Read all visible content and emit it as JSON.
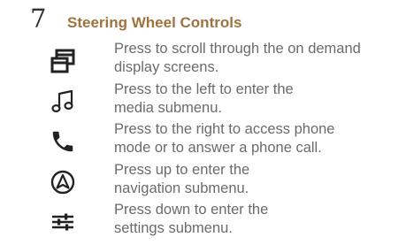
{
  "header": {
    "section_number": "7",
    "title": "Steering Wheel Controls"
  },
  "items": [
    {
      "icon": "screens-icon",
      "line1": "Press to scroll through the on demand",
      "line2": "display screens."
    },
    {
      "icon": "music-note-icon",
      "line1": "Press to the left to enter the",
      "line2": "media submenu."
    },
    {
      "icon": "phone-icon",
      "line1": "Press to the right to access phone",
      "line2": "mode or to answer a phone call."
    },
    {
      "icon": "navigation-icon",
      "line1": "Press up to enter the",
      "line2": "navigation submenu."
    },
    {
      "icon": "settings-sliders-icon",
      "line1": "Press down to enter the",
      "line2": "settings submenu."
    }
  ]
}
